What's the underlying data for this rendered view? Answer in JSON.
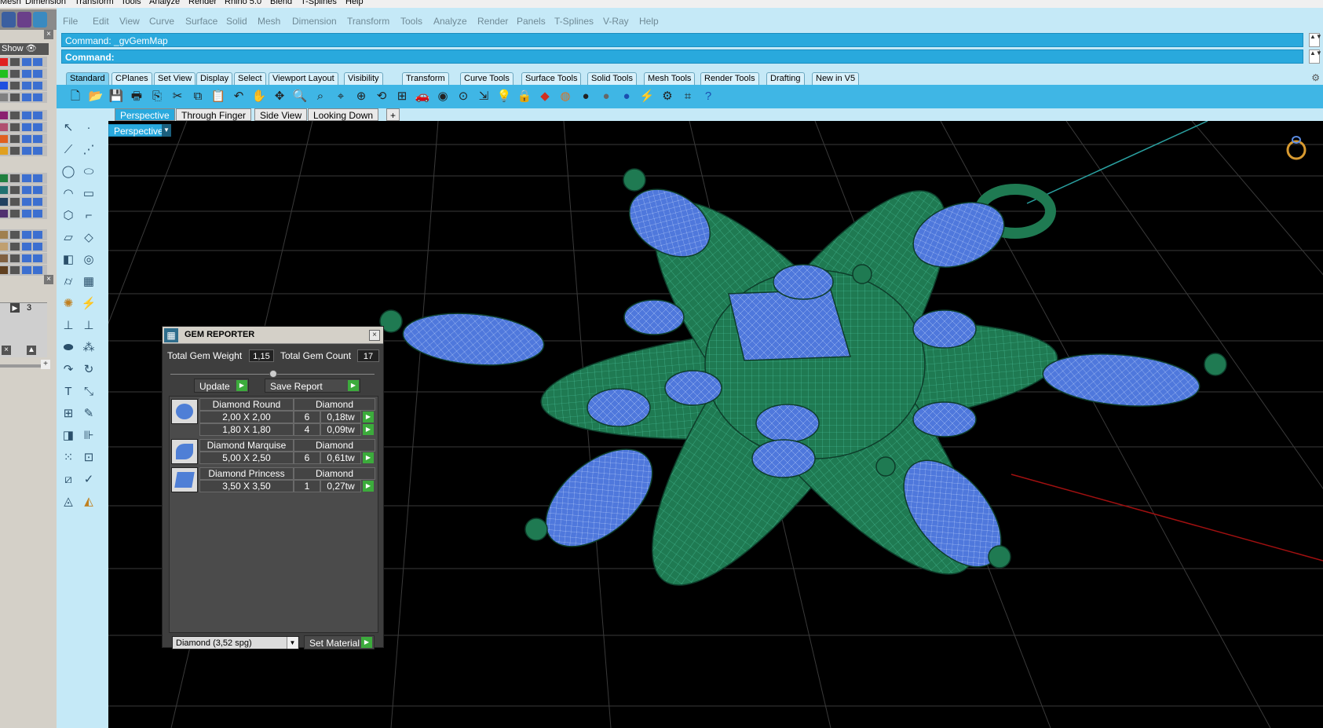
{
  "top_menubar": [
    "Mesh",
    "Dimension",
    "Transform",
    "Tools",
    "Analyze",
    "Render",
    "Rhino 5.0",
    "Blend",
    "T-Splines",
    "Help"
  ],
  "menubar": [
    "File",
    "Edit",
    "View",
    "Curve",
    "Surface",
    "Solid",
    "Mesh",
    "Dimension",
    "Transform",
    "Tools",
    "Analyze",
    "Render",
    "Panels",
    "T-Splines",
    "V-Ray",
    "Help"
  ],
  "command": {
    "history_line": "Command: _gvGemMap",
    "prompt_label": "Command:"
  },
  "toolbar_tabs": [
    "Standard",
    "CPlanes",
    "Set View",
    "Display",
    "Select",
    "Viewport Layout",
    "Visibility",
    "Transform",
    "Curve Tools",
    "Surface Tools",
    "Solid Tools",
    "Mesh Tools",
    "Render Tools",
    "Drafting",
    "New in V5"
  ],
  "toolbar_icons": [
    "new-icon",
    "open-icon",
    "save-icon",
    "print-icon",
    "import-icon",
    "cut-icon",
    "copy-icon",
    "paste-icon",
    "undo-icon",
    "pan-icon",
    "rotate-view-icon",
    "zoom-icon",
    "zoom-window-icon",
    "zoom-extents-icon",
    "zoom-selected-icon",
    "undo-view-icon",
    "four-viewports-icon",
    "car-icon",
    "eye-icon",
    "snap-icon",
    "transform-icon",
    "light-bulb-icon",
    "lock-icon",
    "material-icon",
    "color-wheel-icon",
    "render-sphere-icon",
    "render-sphere2-icon",
    "globe-icon",
    "flash-icon",
    "settings-icon",
    "grid-icon",
    "help-icon"
  ],
  "left_panel": {
    "show_label": "Show",
    "layer_colors": [
      "#e02020",
      "#20c020",
      "#2050e0",
      "#808080",
      "#8a2070",
      "#b05070",
      "#e06020",
      "#e0a020",
      "#208040",
      "#207070",
      "#204060",
      "#503070",
      "#a08050",
      "#c0a070",
      "#806040",
      "#604020"
    ],
    "number": "3"
  },
  "viewport_tabs": [
    "Perspective",
    "Through Finger",
    "Side View",
    "Looking Down"
  ],
  "viewport_label": "Perspective",
  "gem_reporter": {
    "title": "GEM REPORTER",
    "total_weight_label": "Total Gem Weight",
    "total_weight_value": "1,15",
    "total_count_label": "Total Gem Count",
    "total_count_value": "17",
    "update_label": "Update",
    "save_report_label": "Save Report",
    "gems": [
      {
        "name": "Diamond Round",
        "material": "Diamond",
        "rows": [
          {
            "size": "2,00 X 2,00",
            "count": "6",
            "weight": "0,18tw"
          },
          {
            "size": "1,80 X 1,80",
            "count": "4",
            "weight": "0,09tw"
          }
        ]
      },
      {
        "name": "Diamond Marquise",
        "material": "Diamond",
        "rows": [
          {
            "size": "5,00 X 2,50",
            "count": "6",
            "weight": "0,61tw"
          }
        ]
      },
      {
        "name": "Diamond Princess",
        "material": "Diamond",
        "rows": [
          {
            "size": "3,50 X 3,50",
            "count": "1",
            "weight": "0,27tw"
          }
        ]
      }
    ],
    "material_select": "Diamond    (3,52 spg)",
    "set_material_label": "Set Material"
  },
  "colors": {
    "ui_blue": "#c5e9f7",
    "accent_blue": "#29a9dd",
    "mesh_green": "#1f7a52",
    "gem_blue": "#5a82e0"
  }
}
